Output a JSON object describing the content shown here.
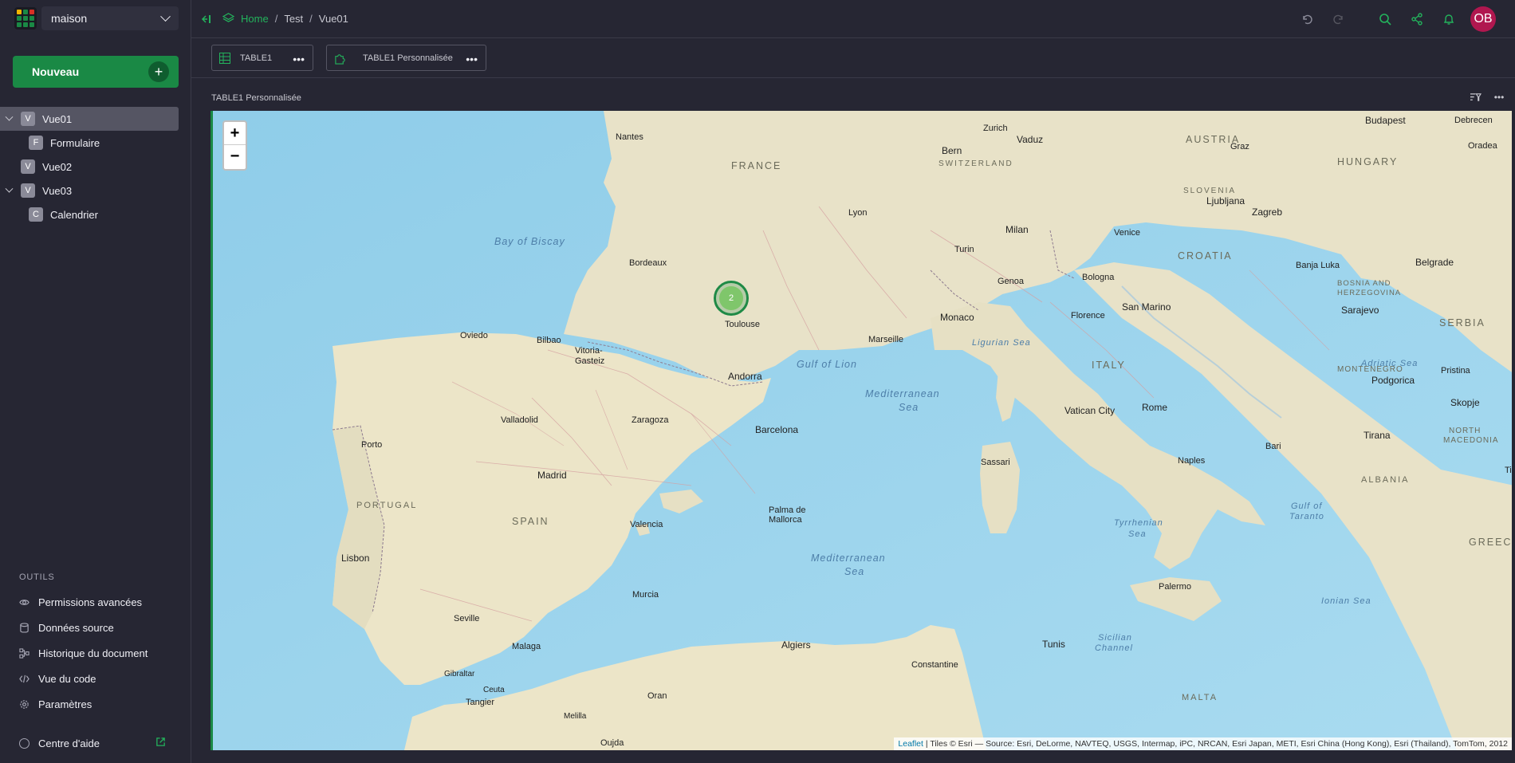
{
  "sidebar": {
    "org_name": "maison",
    "new_button": "Nouveau",
    "pages": [
      {
        "initial": "V",
        "label": "Vue01",
        "selected": true,
        "expanded": true
      },
      {
        "initial": "F",
        "label": "Formulaire"
      },
      {
        "initial": "V",
        "label": "Vue02"
      },
      {
        "initial": "V",
        "label": "Vue03",
        "expanded": true
      },
      {
        "initial": "C",
        "label": "Calendrier"
      }
    ],
    "tools_heading": "OUTILS",
    "tools": [
      {
        "label": "Permissions avancées",
        "icon": "eye-icon"
      },
      {
        "label": "Données source",
        "icon": "database-icon"
      },
      {
        "label": "Historique du document",
        "icon": "history-icon"
      },
      {
        "label": "Vue du code",
        "icon": "code-icon"
      },
      {
        "label": "Paramètres",
        "icon": "gear-icon"
      }
    ],
    "help": "Centre d'aide"
  },
  "header": {
    "breadcrumb": [
      "Home",
      "Test",
      "Vue01"
    ],
    "avatar_initials": "OB"
  },
  "widgets": [
    {
      "label": "TABLE1",
      "icon": "table-icon"
    },
    {
      "label": "TABLE1 Personnalisée",
      "icon": "puzzle-icon"
    }
  ],
  "section": {
    "title": "TABLE1 Personnalisée"
  },
  "map": {
    "cluster_count": "2",
    "zoom_in": "+",
    "zoom_out": "−",
    "attribution_link": "Leaflet",
    "attribution_text": "| Tiles © Esri — Source: Esri, DeLorme, NAVTEQ, USGS, Intermap, iPC, NRCAN, Esri Japan, METI, Esri China (Hong Kong), Esri (Thailand), TomTom, 2012",
    "place_labels": {
      "cities": [
        "Nantes",
        "Bordeaux",
        "Toulouse",
        "Lyon",
        "Marseille",
        "Monaco",
        "Zurich",
        "Bern",
        "Vaduz",
        "Milan",
        "Turin",
        "Genoa",
        "Bologna",
        "Venice",
        "Florence",
        "San Marino",
        "Rome",
        "Vatican City",
        "Naples",
        "Bari",
        "Palermo",
        "Sassari",
        "Ljubljana",
        "Zagreb",
        "Graz",
        "Budapest",
        "Debrecen",
        "Oradea",
        "Banja Luka",
        "Belgrade",
        "Sarajevo",
        "Podgorica",
        "Pristina",
        "Skopje",
        "Tirana",
        "Oviedo",
        "Bilbao",
        "Vitoria-Gasteiz",
        "Valladolid",
        "Zaragoza",
        "Andorra",
        "Barcelona",
        "Porto",
        "Madrid",
        "Valencia",
        "Palma de Mallorca",
        "Lisbon",
        "Murcia",
        "Seville",
        "Malaga",
        "Gibraltar",
        "Ceuta",
        "Tangier",
        "Oran",
        "Melilla",
        "Oujda",
        "Algiers",
        "Constantine",
        "Tunis",
        "Ti"
      ],
      "countries": [
        "FRANCE",
        "SWITZERLAND",
        "AUSTRIA",
        "HUNGARY",
        "SLOVENIA",
        "CROATIA",
        "BOSNIA AND HERZEGOVINA",
        "SERBIA",
        "MONTENEGRO",
        "NORTH MACEDONIA",
        "ALBANIA",
        "GREECE",
        "ITALY",
        "SPAIN",
        "PORTUGAL",
        "MALTA"
      ],
      "seas": [
        "Bay of Biscay",
        "Gulf of Lion",
        "Ligurian Sea",
        "Mediterranean Sea",
        "Adriatic Sea",
        "Tyrrhenian Sea",
        "Gulf of Taranto",
        "Ionian Sea",
        "Sicilian Channel"
      ]
    }
  },
  "colors": {
    "accent": "#1a8945",
    "sidebar_bg": "#262633",
    "avatar_bg": "#b0174f",
    "link_green": "#23b35c"
  }
}
